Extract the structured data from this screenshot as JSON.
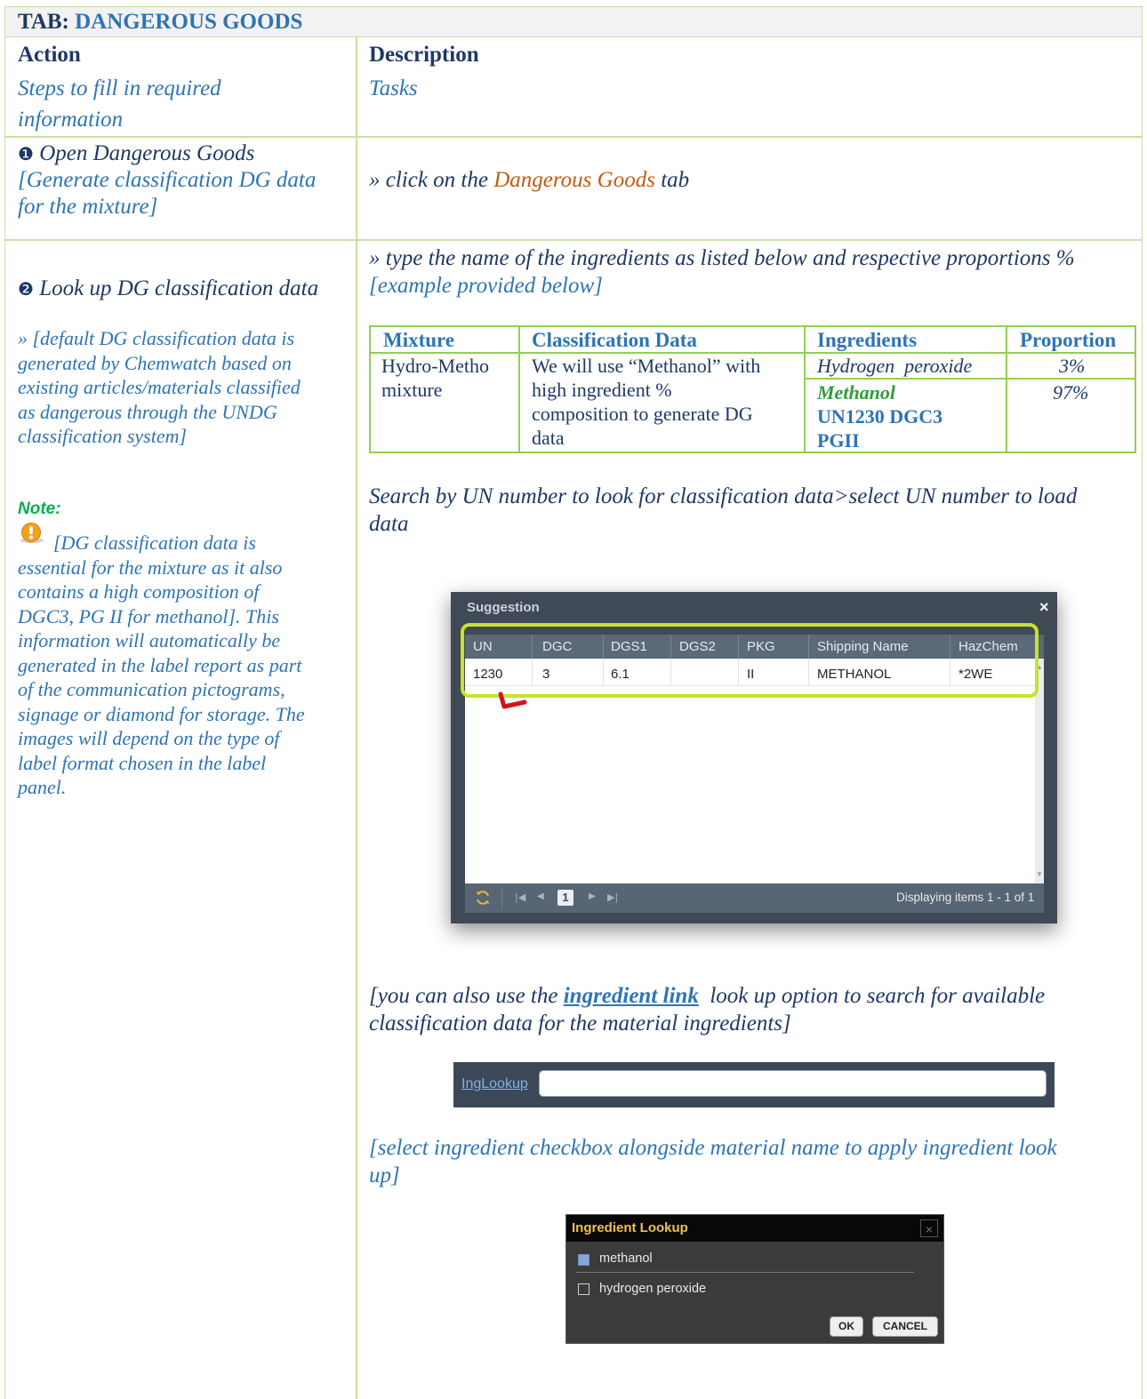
{
  "header": {
    "prefix": "TAB:",
    "tab_name": "DANGEROUS GOODS"
  },
  "columns": {
    "action": "Action",
    "description": "Description"
  },
  "row1": {
    "action_line1": "Steps to fill in required",
    "action_line2": "information",
    "description": "Tasks"
  },
  "row2": {
    "bullet": "❶",
    "step_title": "Open Dangerous Goods",
    "step_sub_line1": "[Generate classification DG data",
    "step_sub_line2": "for the mixture]",
    "desc_prefix": "» click on the",
    "desc_link": "Dangerous Goods",
    "desc_suffix": "tab"
  },
  "row3": {
    "bullet": "❷",
    "step_title": "Look up DG classification data",
    "default_note": [
      "» [default DG classification data is",
      "generated by Chemwatch based on",
      "existing articles/materials classified",
      "as dangerous through the UNDG",
      "classification system]"
    ],
    "note_label": "Note:",
    "note_icon": "warning-icon",
    "note_text": [
      "[DG classification data is",
      "essential for the mixture as it also",
      "contains a high composition of",
      "DGC3, PG II for methanol]. This",
      "information will automatically be",
      "generated in the label report as part",
      "of the communication pictograms,",
      "signage or diamond for storage. The",
      "images will depend on the type of",
      "label format chosen in the label",
      "panel."
    ],
    "instr_line1": "» type the name of the ingredients as listed below and respective proportions %",
    "instr_line2": "[example provided below]",
    "search_line1": "Search by UN number to look for classification data>select UN number to load",
    "search_line2": "data",
    "also_prefix": "[you can also use the",
    "also_link": "ingredient link",
    "also_suffix": "look up option to search for available",
    "also_line2": "classification data for the material ingredients]",
    "select_line1": "[select ingredient checkbox alongside material name to apply ingredient look",
    "select_line2": "up]"
  },
  "mixture_table": {
    "headers": [
      "Mixture",
      "Classification Data",
      "Ingredients",
      "Proportion"
    ],
    "mixture": [
      "Hydro-Metho",
      "mixture"
    ],
    "classification": [
      "We will use “Methanol” with",
      "high ingredient %",
      "composition to generate DG",
      "data"
    ],
    "ingredient1": "Hydrogen  peroxide",
    "proportion1": "3%",
    "ingredient2": "Methanol",
    "ingredient2_dg_line1": "UN1230 DGC3",
    "ingredient2_dg_line2": "PGII",
    "proportion2": "97%"
  },
  "suggestion_dialog": {
    "title": "Suggestion",
    "close": "×",
    "columns": [
      "UN",
      "DGC",
      "DGS1",
      "DGS2",
      "PKG",
      "Shipping Name",
      "HazChem"
    ],
    "row": [
      "1230",
      "3",
      "6.1",
      "",
      "II",
      "METHANOL",
      "*2WE"
    ],
    "page": "1",
    "status": "Displaying items 1 - 1 of 1",
    "icons": [
      "refresh-icon",
      "first-page-icon",
      "prev-page-icon",
      "next-page-icon",
      "last-page-icon"
    ]
  },
  "ing_lookup_bar": {
    "link": "IngLookup",
    "value": ""
  },
  "ingredient_dialog": {
    "title": "Ingredient Lookup",
    "close": "×",
    "items": [
      {
        "label": "methanol",
        "checked": true
      },
      {
        "label": "hydrogen peroxide",
        "checked": false
      }
    ],
    "ok": "OK",
    "cancel": "CANCEL"
  },
  "colors": {
    "grid_line": "#c9dfa5",
    "title_blue": "#2e74b5",
    "navy": "#1f3864",
    "orange": "#c55a11",
    "highlight_green": "#c9e32a",
    "note_green": "#00b050",
    "methanol_green": "#2e9e3a"
  }
}
